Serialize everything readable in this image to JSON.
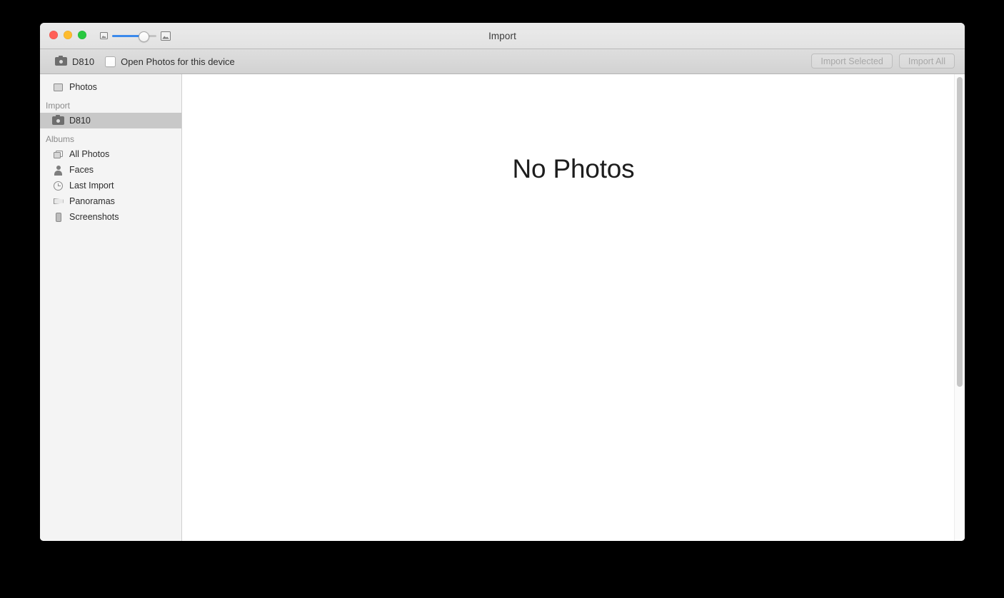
{
  "window": {
    "title": "Import",
    "traffic_lights": [
      {
        "name": "close",
        "color": "#ff5f57"
      },
      {
        "name": "minimize",
        "color": "#febc2e"
      },
      {
        "name": "maximize",
        "color": "#28c840"
      }
    ],
    "zoom_slider": {
      "min_icon": "small-photo-icon",
      "max_icon": "large-photo-icon",
      "value_percent": 70,
      "fill_color": "#3b8aec"
    }
  },
  "toolbar": {
    "device_icon": "camera-icon",
    "device_name": "D810",
    "open_photos_checkbox": {
      "label": "Open Photos for this device",
      "checked": false
    },
    "import_selected_label": "Import Selected",
    "import_all_label": "Import All",
    "buttons_disabled": true
  },
  "sidebar": {
    "top_items": [
      {
        "label": "Photos",
        "icon": "photos-icon",
        "selected": false
      }
    ],
    "sections": [
      {
        "header": "Import",
        "items": [
          {
            "label": "D810",
            "icon": "camera-icon",
            "selected": true
          }
        ]
      },
      {
        "header": "Albums",
        "items": [
          {
            "label": "All Photos",
            "icon": "all-photos-icon",
            "selected": false
          },
          {
            "label": "Faces",
            "icon": "faces-icon",
            "selected": false
          },
          {
            "label": "Last Import",
            "icon": "clock-icon",
            "selected": false
          },
          {
            "label": "Panoramas",
            "icon": "panorama-icon",
            "selected": false
          },
          {
            "label": "Screenshots",
            "icon": "screenshots-icon",
            "selected": false
          }
        ]
      }
    ],
    "selected_background": "#c8c8c8"
  },
  "content": {
    "empty_message": "No Photos",
    "scrollbar": {
      "thumb_color": "#c6c6c6"
    }
  }
}
